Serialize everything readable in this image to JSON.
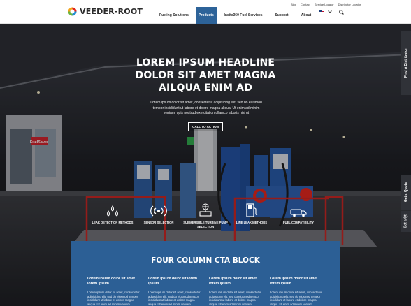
{
  "brand": {
    "name": "VEEDER-ROOT"
  },
  "utility_links": [
    "Blog",
    "Contact",
    "Service Locator",
    "Distributor Locator"
  ],
  "nav": {
    "items": [
      "Fueling Solutions",
      "Products",
      "Insite360 Fuel Services",
      "Support",
      "About"
    ],
    "active": "Products"
  },
  "hero": {
    "title": "LOREM IPSUM HEADLINE DOLOR SIT AMET MAGNA AILQUA ENIM AD",
    "body": "Lorem ipsum dolor sit amet, consectetur adipisicing elit, sed do eiusmod tempor incididunt ut labore et dolore magna aliqua. Ut enim ad minim veniam, quis nostrud exercitation ullamco laboris nisi ut",
    "cta_label": "CALL TO ACTION",
    "sign_text": "FuelSaver"
  },
  "features": [
    {
      "label": "LEAK DETECTION METHODS",
      "icon": "droplets-icon"
    },
    {
      "label": "SENSOR SELECTION",
      "icon": "sensor-icon"
    },
    {
      "label": "SUBMERSIBLE TURBINE PUMP SELECTION",
      "icon": "pump-icon"
    },
    {
      "label": "LINE LEAK METHODS",
      "icon": "fuel-pump-icon"
    },
    {
      "label": "FUEL COMPATIBILITY",
      "icon": "truck-icon"
    }
  ],
  "side_tabs": [
    "Find A Distributor",
    "Get a Quote",
    "Get a Qt"
  ],
  "cta_block": {
    "title": "FOUR COLUMN CTA BLOCK",
    "columns": [
      {
        "heading": "Lorem ipsum dolor sit amet lorem ipsum",
        "body": "Lorem ipsum dolor sit amet, consectetur adipisicing elit, sed do eiusmod tempor incididunt ut labore et dolore magna aliqua. Ut enim ad minim veniam"
      },
      {
        "heading": "Lorem ipsum dolor sit lorem ipsum",
        "body": "Lorem ipsum dolor sit amet, consectetur adipisicing elit, sed do eiusmod tempor incididunt ut labore et dolore magna aliqua. Ut enim ad minim veniam"
      },
      {
        "heading": "Lorem ipsum dolor sit amet lorem ipsum",
        "body": "Lorem ipsum dolor sit amet, consectetur adipisicing elit, sed do eiusmod tempor incididunt ut labore et dolore magna aliqua. Ut enim ad minim veniam"
      },
      {
        "heading": "Lorem ipsum dolor sit amet lorem ipsum",
        "body": "Lorem ipsum dolor sit amet, consectetur adipisicing elit, sed do eiusmod tempor incididunt ut labore et dolore magna aliqua. Ut enim ad minim veniam"
      }
    ]
  },
  "colors": {
    "primary_blue": "#2c5f95",
    "nav_active": "#2d6399",
    "hero_dark": "#1b1c20"
  }
}
